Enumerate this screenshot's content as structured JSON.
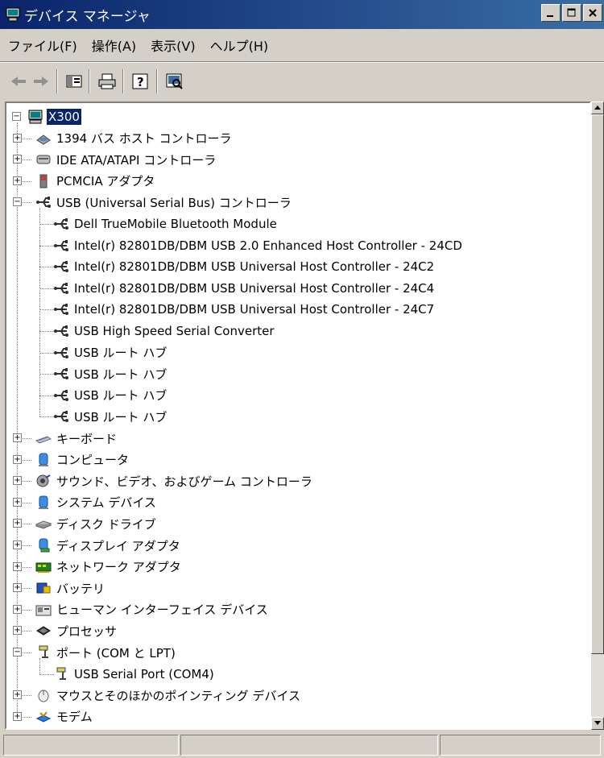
{
  "window": {
    "title": "デバイス マネージャ"
  },
  "menu": [
    {
      "label": "ファイル(F)"
    },
    {
      "label": "操作(A)"
    },
    {
      "label": "表示(V)"
    },
    {
      "label": "ヘルプ(H)"
    }
  ],
  "tree": {
    "root": "X300",
    "items": [
      {
        "label": "1394 バス ホスト コントローラ",
        "icon": "ieee1394-icon",
        "depth": 1,
        "expander": "plus"
      },
      {
        "label": "IDE ATA/ATAPI コントローラ",
        "icon": "ide-controller-icon",
        "depth": 1,
        "expander": "plus"
      },
      {
        "label": "PCMCIA アダプタ",
        "icon": "pcmcia-icon",
        "depth": 1,
        "expander": "plus"
      },
      {
        "label": "USB (Universal Serial Bus) コントローラ",
        "icon": "usb-icon",
        "depth": 1,
        "expander": "minus"
      },
      {
        "label": "Dell TrueMobile Bluetooth Module",
        "icon": "usb-icon",
        "depth": 2
      },
      {
        "label": "Intel(r) 82801DB/DBM USB 2.0 Enhanced Host Controller - 24CD",
        "icon": "usb-icon",
        "depth": 2
      },
      {
        "label": "Intel(r) 82801DB/DBM USB Universal Host Controller - 24C2",
        "icon": "usb-icon",
        "depth": 2
      },
      {
        "label": "Intel(r) 82801DB/DBM USB Universal Host Controller - 24C4",
        "icon": "usb-icon",
        "depth": 2
      },
      {
        "label": "Intel(r) 82801DB/DBM USB Universal Host Controller - 24C7",
        "icon": "usb-icon",
        "depth": 2
      },
      {
        "label": "USB High Speed Serial Converter",
        "icon": "usb-icon",
        "depth": 2
      },
      {
        "label": "USB ルート ハブ",
        "icon": "usb-icon",
        "depth": 2
      },
      {
        "label": "USB ルート ハブ",
        "icon": "usb-icon",
        "depth": 2
      },
      {
        "label": "USB ルート ハブ",
        "icon": "usb-icon",
        "depth": 2
      },
      {
        "label": "USB ルート ハブ",
        "icon": "usb-icon",
        "depth": 2
      },
      {
        "label": "キーボード",
        "icon": "keyboard-icon",
        "depth": 1,
        "expander": "plus"
      },
      {
        "label": "コンピュータ",
        "icon": "computer-icon",
        "depth": 1,
        "expander": "plus"
      },
      {
        "label": "サウンド、ビデオ、およびゲーム コントローラ",
        "icon": "sound-icon",
        "depth": 1,
        "expander": "plus"
      },
      {
        "label": "システム デバイス",
        "icon": "system-device-icon",
        "depth": 1,
        "expander": "plus"
      },
      {
        "label": "ディスク ドライブ",
        "icon": "disk-drive-icon",
        "depth": 1,
        "expander": "plus"
      },
      {
        "label": "ディスプレイ アダプタ",
        "icon": "display-adapter-icon",
        "depth": 1,
        "expander": "plus"
      },
      {
        "label": "ネットワーク アダプタ",
        "icon": "network-adapter-icon",
        "depth": 1,
        "expander": "plus"
      },
      {
        "label": "バッテリ",
        "icon": "battery-icon",
        "depth": 1,
        "expander": "plus"
      },
      {
        "label": "ヒューマン インターフェイス デバイス",
        "icon": "hid-icon",
        "depth": 1,
        "expander": "plus"
      },
      {
        "label": "プロセッサ",
        "icon": "processor-icon",
        "depth": 1,
        "expander": "plus"
      },
      {
        "label": "ポート (COM と LPT)",
        "icon": "port-icon",
        "depth": 1,
        "expander": "minus"
      },
      {
        "label": "USB Serial Port (COM4)",
        "icon": "port-icon",
        "depth": 2
      },
      {
        "label": "マウスとそのほかのポインティング デバイス",
        "icon": "mouse-icon",
        "depth": 1,
        "expander": "plus"
      },
      {
        "label": "モデム",
        "icon": "modem-icon",
        "depth": 1,
        "expander": "plus"
      }
    ]
  },
  "colors": {
    "titlebar_start": "#0a246a",
    "titlebar_end": "#3a6ea5",
    "selection": "#0a246a",
    "face": "#d4d0c8"
  }
}
